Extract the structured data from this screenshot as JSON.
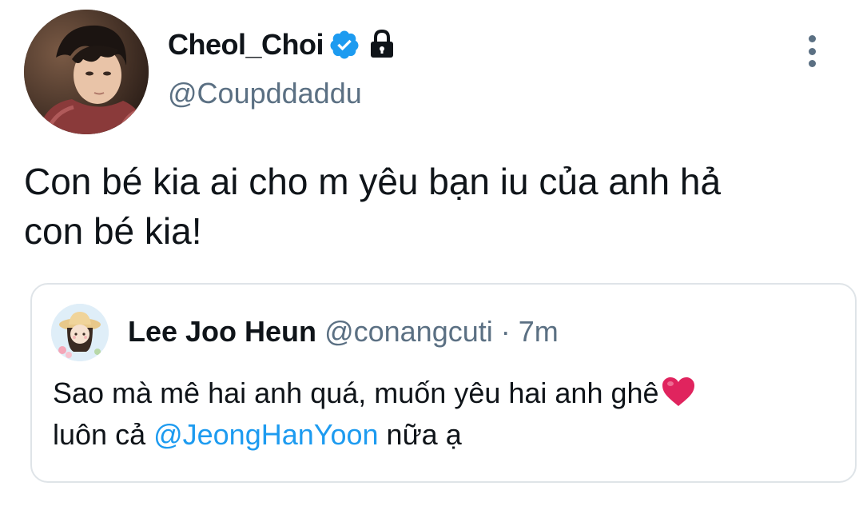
{
  "tweet": {
    "author": {
      "display_name": "Cheol_Choi",
      "handle": "@Coupddaddu",
      "verified_icon": "verified-badge-icon",
      "locked_icon": "lock-icon"
    },
    "text_line1": "Con bé kia ai cho m yêu bạn iu của anh hả",
    "text_line2": "con bé kia!",
    "more_icon": "more-vertical-icon"
  },
  "quote": {
    "author": {
      "display_name": "Lee Joo Heun",
      "handle": "@conangcuti",
      "separator": "·",
      "time": "7m"
    },
    "text_line1": "Sao mà mê hai anh quá, muốn yêu hai anh ghê",
    "heart_icon": "red-heart-emoji",
    "text_line2_prefix": "luôn cả ",
    "mention": "@JeongHanYoon",
    "text_line2_suffix": " nữa ạ"
  },
  "colors": {
    "text_primary": "#0f1419",
    "text_secondary": "#5b7083",
    "link": "#1d9bf0",
    "verified": "#1d9bf0",
    "border": "#dfe4e8",
    "heart": "#e0245e"
  }
}
